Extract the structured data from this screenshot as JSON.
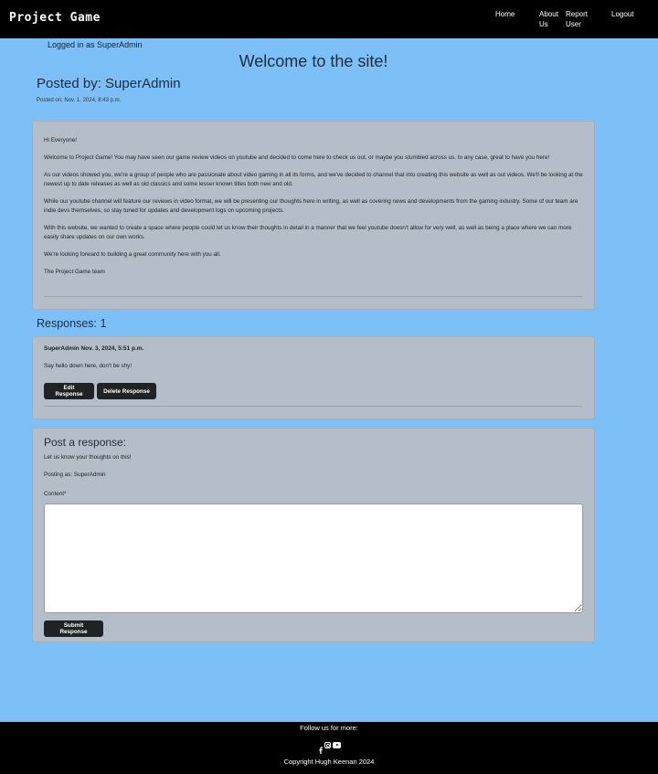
{
  "nav": {
    "brand": "Project Game",
    "links": [
      "Home",
      "About Us",
      "Report User",
      "Logout"
    ]
  },
  "status": {
    "logged_in": "Logged in as SuperAdmin"
  },
  "page": {
    "title": "Welcome to the site!",
    "posted_by": "Posted by: SuperAdmin",
    "posted_on": "Posted on: Nov. 1, 2024, 8:43 p.m."
  },
  "post": {
    "paragraphs": [
      "Hi Everyone!",
      "Welcome to Project Game! You may have seen our game review videos on youtube and decided to come here to check us out, or maybe you stumbled across us. In any case, great to have you here!",
      "As our videos showed you, we're a group of people who are passionate about video gaming in all its forms, and we've decided to channel that into creating this website as well as out videos. We'll be looking at the newest up to date releases as well as old classics and some lesser known titles both new and old.",
      "While our youtube channel will feature our reviews in video format, we will be presenting our thoughts here in writing, as well as covering news and developments from the gaming industry. Some of our team are indie devs themselves, so stay tuned for updates and development logs on upcoming projects.",
      "With this website, we wanted to create a space where people could let us know their thoughts in detail in a manner that we feel youtube doesn't allow for very well, as well as being a place where we can more easily share updates on our own works.",
      "We're looking forward to building a great community here with you all.",
      "The Project Game team"
    ]
  },
  "responses": {
    "heading": "Responses: 1",
    "items": [
      {
        "meta": "SuperAdmin Nov. 3, 2024, 5:51 p.m.",
        "body": "Say hello down here, don't be shy!",
        "edit_label": "Edit Response",
        "delete_label": "Delete Response"
      }
    ]
  },
  "form": {
    "title": "Post a response:",
    "hint": "Let us know your thoughts on this!",
    "posting_as": "Posting as: SuperAdmin",
    "content_label": "Content*",
    "content_value": "",
    "submit_label": "Submit Response"
  },
  "footer": {
    "follow": "Follow us for more:",
    "social_icons": [
      "facebook-icon",
      "instagram-icon",
      "youtube-icon"
    ],
    "copyright": "Copyright Hugh Keenan 2024"
  },
  "colors": {
    "background": "#7cc0f7",
    "navbar": "#000000",
    "card": "#b3bec9",
    "button": "#202326"
  }
}
